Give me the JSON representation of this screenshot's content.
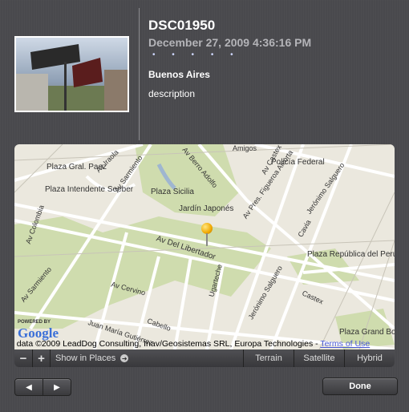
{
  "photo": {
    "title": "DSC01950",
    "date": "December 27, 2009 4:36:16 PM",
    "rating_dots": "• • • • •",
    "place": "Buenos Aires",
    "description": "description"
  },
  "map": {
    "labels": [
      "Av Iraola",
      "Av Sarmiento",
      "Amigos",
      "Av Castex",
      "Plaza Gral. Paez",
      "Av Berro Adolfo",
      "Policía Federal",
      "Plaza Intendente Seeber",
      "Plaza Sicilia",
      "Av Pres. Figueroa Alcorta",
      "Jerónimo Salguero",
      "Jardín Japonés",
      "Av Colombia",
      "Av Del Libertador",
      "Cavia",
      "Plaza República del Perú",
      "Av Sarmiento",
      "Av Cervino",
      "Jerónimo Salguero",
      "Castex",
      "Juan María Gutiérrez",
      "Cabello",
      "Plaza Grand Bourg",
      "Ugarteche"
    ],
    "powered_by": "POWERED BY",
    "logo": "Google",
    "attribution": "p data ©2009 LeadDog Consulting, Inav/Geosistemas SRL, Europa Technologies - ",
    "terms": "Terms of Use"
  },
  "controls": {
    "zoom_out": "−",
    "zoom_in": "+",
    "show_in_places": "Show in Places",
    "terrain": "Terrain",
    "satellite": "Satellite",
    "hybrid": "Hybrid"
  },
  "footer": {
    "prev": "◀",
    "next": "▶",
    "done": "Done"
  }
}
